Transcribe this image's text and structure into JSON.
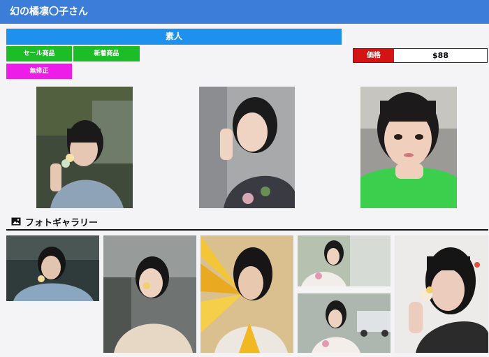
{
  "header": {
    "title": "幻の橘凛〇子さん"
  },
  "category": {
    "label": "素人"
  },
  "tags": {
    "sale": "セール商品",
    "new": "新着商品",
    "uncensored": "無修正"
  },
  "price": {
    "label": "価格",
    "value": "$88"
  },
  "gallery": {
    "heading": "フォトギャラリー",
    "icon": "image-icon"
  },
  "colors": {
    "header_bg": "#3b7dd8",
    "category_bg": "#1e90ee",
    "tag_green": "#1dbd2a",
    "tag_magenta": "#ee1ce8",
    "price_red": "#d41414"
  }
}
